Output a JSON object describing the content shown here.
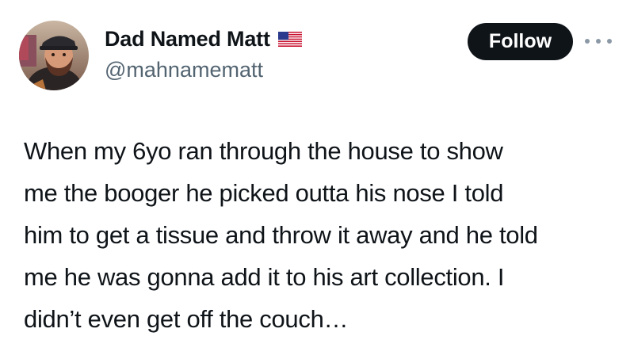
{
  "author": {
    "display_name": "Dad Named Matt",
    "flag_icon": "us-flag-icon",
    "handle": "@mahnamematt",
    "avatar_icon": "profile-photo"
  },
  "actions": {
    "follow_label": "Follow",
    "more_icon": "more-options-icon"
  },
  "tweet": {
    "lines": [
      "When my 6yo ran through the house to show",
      "me the booger he picked outta his nose I told",
      "him to get a tissue and throw it away and he told",
      "me he was gonna add it to his art collection. I",
      "didn’t even get off the couch…"
    ]
  },
  "colors": {
    "follow_button_bg": "#0f1419",
    "text": "#0f1419",
    "secondary_text": "#536471"
  }
}
